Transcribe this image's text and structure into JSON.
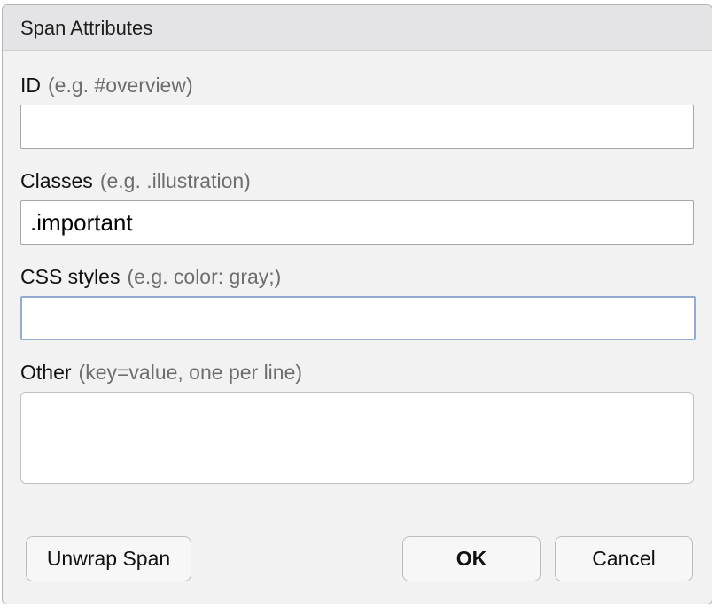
{
  "dialog": {
    "title": "Span Attributes"
  },
  "fields": {
    "id": {
      "label": "ID",
      "hint": "(e.g. #overview)",
      "value": ""
    },
    "classes": {
      "label": "Classes",
      "hint": "(e.g. .illustration)",
      "value": ".important"
    },
    "css": {
      "label": "CSS styles",
      "hint": "(e.g. color: gray;)",
      "value": ""
    },
    "other": {
      "label": "Other",
      "hint": "(key=value, one per line)",
      "value": ""
    }
  },
  "buttons": {
    "unwrap": "Unwrap Span",
    "ok": "OK",
    "cancel": "Cancel"
  },
  "colors": {
    "focus_border": "#93acd3",
    "dialog_bg": "#f2f2f2",
    "titlebar_bg": "#e4e4e6"
  }
}
